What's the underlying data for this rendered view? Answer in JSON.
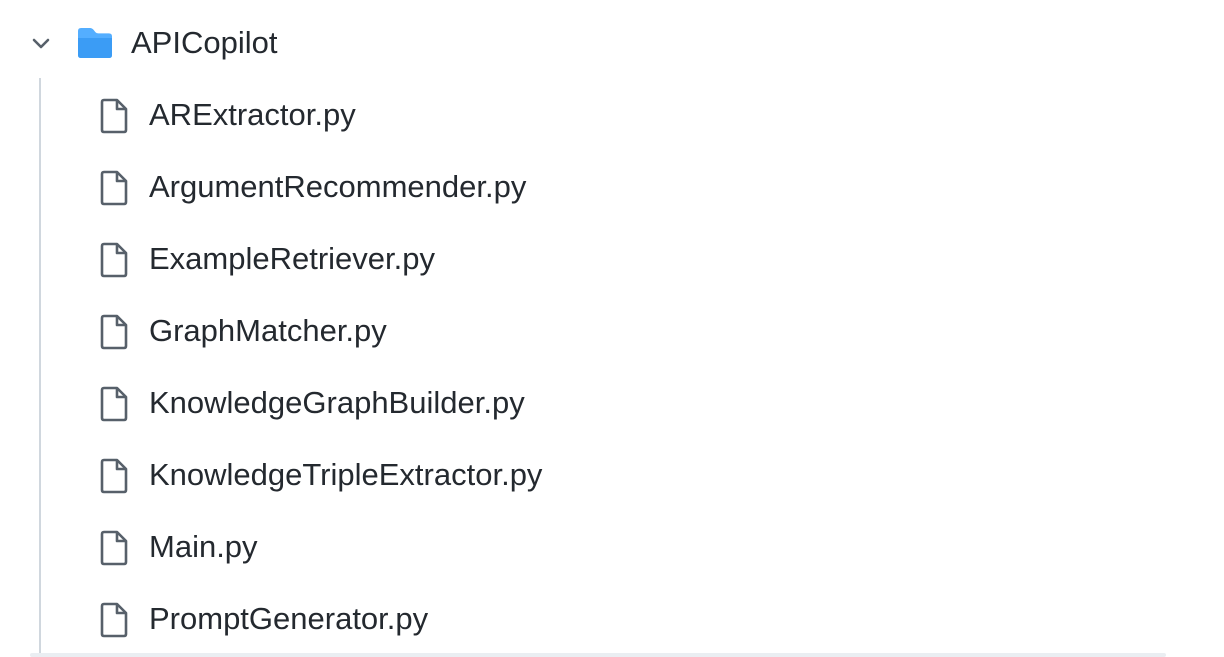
{
  "tree": {
    "folder": {
      "name": "APICopilot",
      "expanded": true,
      "icon": "folder-icon",
      "chevron_icon": "chevron-down-icon",
      "color": "#54aeff"
    },
    "files": [
      {
        "name": "ARExtractor.py",
        "icon": "file-icon"
      },
      {
        "name": "ArgumentRecommender.py",
        "icon": "file-icon"
      },
      {
        "name": "ExampleRetriever.py",
        "icon": "file-icon"
      },
      {
        "name": "GraphMatcher.py",
        "icon": "file-icon"
      },
      {
        "name": "KnowledgeGraphBuilder.py",
        "icon": "file-icon"
      },
      {
        "name": "KnowledgeTripleExtractor.py",
        "icon": "file-icon"
      },
      {
        "name": "Main.py",
        "icon": "file-icon"
      },
      {
        "name": "PromptGenerator.py",
        "icon": "file-icon"
      }
    ]
  }
}
